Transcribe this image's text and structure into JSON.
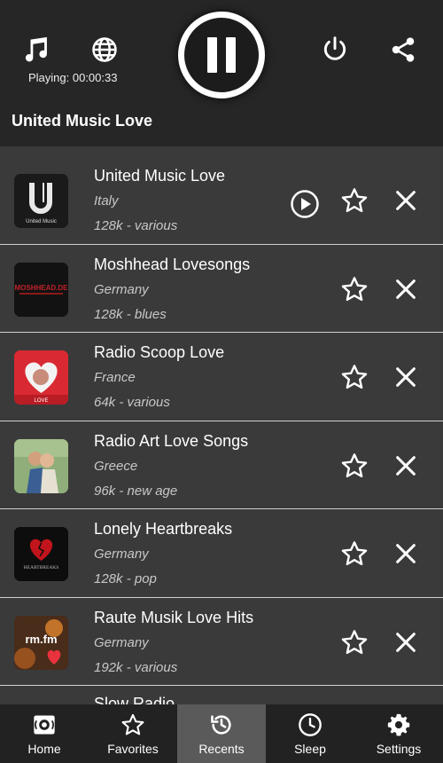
{
  "header": {
    "playing_text": "Playing: 00:00:33",
    "current_station": "United Music Love"
  },
  "stations": [
    {
      "name": "United Music Love",
      "country": "Italy",
      "bitrate": "128k - various",
      "logo_text": "United Music",
      "playing": true
    },
    {
      "name": "Moshhead Lovesongs",
      "country": "Germany",
      "bitrate": "128k - blues",
      "logo_text": "MOSHHEAD.DE",
      "playing": false
    },
    {
      "name": "Radio Scoop Love",
      "country": "France",
      "bitrate": "64k - various",
      "logo_text": "LOVE",
      "playing": false
    },
    {
      "name": "Radio Art Love Songs",
      "country": "Greece",
      "bitrate": "96k - new age",
      "logo_text": "",
      "playing": false
    },
    {
      "name": "Lonely Heartbreaks",
      "country": "Germany",
      "bitrate": "128k - pop",
      "logo_text": "HEARTBREAKS",
      "playing": false
    },
    {
      "name": "Raute Musik Love Hits",
      "country": "Germany",
      "bitrate": "192k - various",
      "logo_text": "rm.fm",
      "playing": false
    },
    {
      "name": "Slow Radio",
      "country": "",
      "bitrate": "",
      "logo_text": "",
      "playing": false
    }
  ],
  "nav": {
    "home": "Home",
    "favorites": "Favorites",
    "recents": "Recents",
    "sleep": "Sleep",
    "settings": "Settings",
    "active": "recents"
  },
  "colors": {
    "header_bg": "#262626",
    "list_bg": "#3a3a3a",
    "nav_bg": "#222222",
    "nav_active_bg": "#5a5a5a"
  }
}
